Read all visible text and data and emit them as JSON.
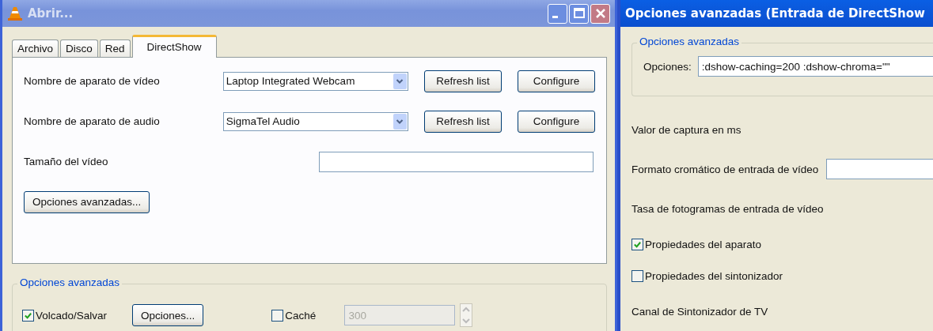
{
  "open_window": {
    "title": "Abrir...",
    "tabs": [
      {
        "label": "Archivo",
        "selected": false
      },
      {
        "label": "Disco",
        "selected": false
      },
      {
        "label": "Red",
        "selected": false
      },
      {
        "label": "DirectShow",
        "selected": true
      }
    ],
    "rows": [
      {
        "kind": "device",
        "label": "Nombre de aparato de vídeo",
        "value": "Laptop Integrated Webcam",
        "buttons": [
          "Refresh list",
          "Configure"
        ]
      },
      {
        "kind": "device",
        "label": "Nombre de aparato de audio",
        "value": "SigmaTel Audio",
        "buttons": [
          "Refresh list",
          "Configure"
        ]
      },
      {
        "kind": "text",
        "label": "Tamaño del vídeo"
      },
      {
        "kind": "button",
        "label": "Opciones avanzadas..."
      }
    ],
    "advanced": {
      "legend": "Opciones avanzadas",
      "dump": {
        "label": "Volcado/Salvar",
        "checked": true
      },
      "options_button": "Opciones...",
      "cache": {
        "label": "Caché",
        "checked": false,
        "value": "300",
        "disabled": true
      }
    }
  },
  "advanced_window": {
    "title": "Opciones avanzadas (Entrada de DirectShow",
    "group": {
      "legend": "Opciones avanzadas",
      "label": "Opciones:",
      "value": ":dshow-caching=200 :dshow-chroma=\"\""
    },
    "items": [
      {
        "kind": "label",
        "label": "Valor de captura en ms"
      },
      {
        "kind": "field",
        "label": "Formato cromático de entrada de vídeo"
      },
      {
        "kind": "label",
        "label": "Tasa de fotogramas de entrada de vídeo"
      },
      {
        "kind": "checkbox",
        "label": "Propiedades del aparato",
        "checked": true
      },
      {
        "kind": "checkbox",
        "label": "Propiedades del sintonizador",
        "checked": false
      },
      {
        "kind": "label",
        "label": "Canal de Sintonizador de TV"
      }
    ]
  }
}
